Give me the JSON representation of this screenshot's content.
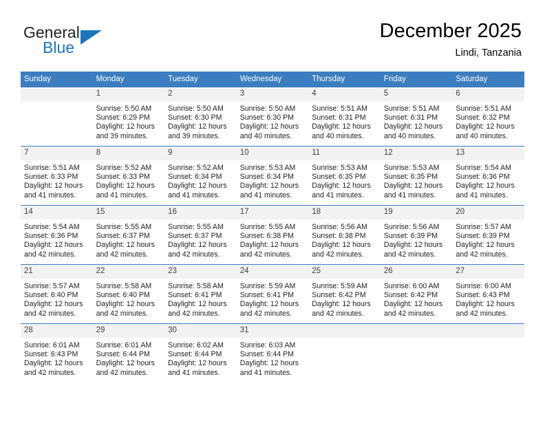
{
  "brand": {
    "name_part1": "General",
    "name_part2": "Blue",
    "colors": {
      "dark": "#231f20",
      "blue": "#1b75bc",
      "header_blue": "#3b7dbf",
      "daynum_band": "#f2f2f2"
    }
  },
  "header": {
    "title": "December 2025",
    "subtitle": "Lindi, Tanzania"
  },
  "weekdays": [
    "Sunday",
    "Monday",
    "Tuesday",
    "Wednesday",
    "Thursday",
    "Friday",
    "Saturday"
  ],
  "weeks": [
    [
      {
        "day": "",
        "lines": []
      },
      {
        "day": "1",
        "lines": [
          "Sunrise: 5:50 AM",
          "Sunset: 6:29 PM",
          "Daylight: 12 hours",
          "and 39 minutes."
        ]
      },
      {
        "day": "2",
        "lines": [
          "Sunrise: 5:50 AM",
          "Sunset: 6:30 PM",
          "Daylight: 12 hours",
          "and 39 minutes."
        ]
      },
      {
        "day": "3",
        "lines": [
          "Sunrise: 5:50 AM",
          "Sunset: 6:30 PM",
          "Daylight: 12 hours",
          "and 40 minutes."
        ]
      },
      {
        "day": "4",
        "lines": [
          "Sunrise: 5:51 AM",
          "Sunset: 6:31 PM",
          "Daylight: 12 hours",
          "and 40 minutes."
        ]
      },
      {
        "day": "5",
        "lines": [
          "Sunrise: 5:51 AM",
          "Sunset: 6:31 PM",
          "Daylight: 12 hours",
          "and 40 minutes."
        ]
      },
      {
        "day": "6",
        "lines": [
          "Sunrise: 5:51 AM",
          "Sunset: 6:32 PM",
          "Daylight: 12 hours",
          "and 40 minutes."
        ]
      }
    ],
    [
      {
        "day": "7",
        "lines": [
          "Sunrise: 5:51 AM",
          "Sunset: 6:33 PM",
          "Daylight: 12 hours",
          "and 41 minutes."
        ]
      },
      {
        "day": "8",
        "lines": [
          "Sunrise: 5:52 AM",
          "Sunset: 6:33 PM",
          "Daylight: 12 hours",
          "and 41 minutes."
        ]
      },
      {
        "day": "9",
        "lines": [
          "Sunrise: 5:52 AM",
          "Sunset: 6:34 PM",
          "Daylight: 12 hours",
          "and 41 minutes."
        ]
      },
      {
        "day": "10",
        "lines": [
          "Sunrise: 5:53 AM",
          "Sunset: 6:34 PM",
          "Daylight: 12 hours",
          "and 41 minutes."
        ]
      },
      {
        "day": "11",
        "lines": [
          "Sunrise: 5:53 AM",
          "Sunset: 6:35 PM",
          "Daylight: 12 hours",
          "and 41 minutes."
        ]
      },
      {
        "day": "12",
        "lines": [
          "Sunrise: 5:53 AM",
          "Sunset: 6:35 PM",
          "Daylight: 12 hours",
          "and 41 minutes."
        ]
      },
      {
        "day": "13",
        "lines": [
          "Sunrise: 5:54 AM",
          "Sunset: 6:36 PM",
          "Daylight: 12 hours",
          "and 41 minutes."
        ]
      }
    ],
    [
      {
        "day": "14",
        "lines": [
          "Sunrise: 5:54 AM",
          "Sunset: 6:36 PM",
          "Daylight: 12 hours",
          "and 42 minutes."
        ]
      },
      {
        "day": "15",
        "lines": [
          "Sunrise: 5:55 AM",
          "Sunset: 6:37 PM",
          "Daylight: 12 hours",
          "and 42 minutes."
        ]
      },
      {
        "day": "16",
        "lines": [
          "Sunrise: 5:55 AM",
          "Sunset: 6:37 PM",
          "Daylight: 12 hours",
          "and 42 minutes."
        ]
      },
      {
        "day": "17",
        "lines": [
          "Sunrise: 5:55 AM",
          "Sunset: 6:38 PM",
          "Daylight: 12 hours",
          "and 42 minutes."
        ]
      },
      {
        "day": "18",
        "lines": [
          "Sunrise: 5:56 AM",
          "Sunset: 6:38 PM",
          "Daylight: 12 hours",
          "and 42 minutes."
        ]
      },
      {
        "day": "19",
        "lines": [
          "Sunrise: 5:56 AM",
          "Sunset: 6:39 PM",
          "Daylight: 12 hours",
          "and 42 minutes."
        ]
      },
      {
        "day": "20",
        "lines": [
          "Sunrise: 5:57 AM",
          "Sunset: 6:39 PM",
          "Daylight: 12 hours",
          "and 42 minutes."
        ]
      }
    ],
    [
      {
        "day": "21",
        "lines": [
          "Sunrise: 5:57 AM",
          "Sunset: 6:40 PM",
          "Daylight: 12 hours",
          "and 42 minutes."
        ]
      },
      {
        "day": "22",
        "lines": [
          "Sunrise: 5:58 AM",
          "Sunset: 6:40 PM",
          "Daylight: 12 hours",
          "and 42 minutes."
        ]
      },
      {
        "day": "23",
        "lines": [
          "Sunrise: 5:58 AM",
          "Sunset: 6:41 PM",
          "Daylight: 12 hours",
          "and 42 minutes."
        ]
      },
      {
        "day": "24",
        "lines": [
          "Sunrise: 5:59 AM",
          "Sunset: 6:41 PM",
          "Daylight: 12 hours",
          "and 42 minutes."
        ]
      },
      {
        "day": "25",
        "lines": [
          "Sunrise: 5:59 AM",
          "Sunset: 6:42 PM",
          "Daylight: 12 hours",
          "and 42 minutes."
        ]
      },
      {
        "day": "26",
        "lines": [
          "Sunrise: 6:00 AM",
          "Sunset: 6:42 PM",
          "Daylight: 12 hours",
          "and 42 minutes."
        ]
      },
      {
        "day": "27",
        "lines": [
          "Sunrise: 6:00 AM",
          "Sunset: 6:43 PM",
          "Daylight: 12 hours",
          "and 42 minutes."
        ]
      }
    ],
    [
      {
        "day": "28",
        "lines": [
          "Sunrise: 6:01 AM",
          "Sunset: 6:43 PM",
          "Daylight: 12 hours",
          "and 42 minutes."
        ]
      },
      {
        "day": "29",
        "lines": [
          "Sunrise: 6:01 AM",
          "Sunset: 6:44 PM",
          "Daylight: 12 hours",
          "and 42 minutes."
        ]
      },
      {
        "day": "30",
        "lines": [
          "Sunrise: 6:02 AM",
          "Sunset: 6:44 PM",
          "Daylight: 12 hours",
          "and 41 minutes."
        ]
      },
      {
        "day": "31",
        "lines": [
          "Sunrise: 6:03 AM",
          "Sunset: 6:44 PM",
          "Daylight: 12 hours",
          "and 41 minutes."
        ]
      },
      {
        "day": "",
        "lines": []
      },
      {
        "day": "",
        "lines": []
      },
      {
        "day": "",
        "lines": []
      }
    ]
  ]
}
